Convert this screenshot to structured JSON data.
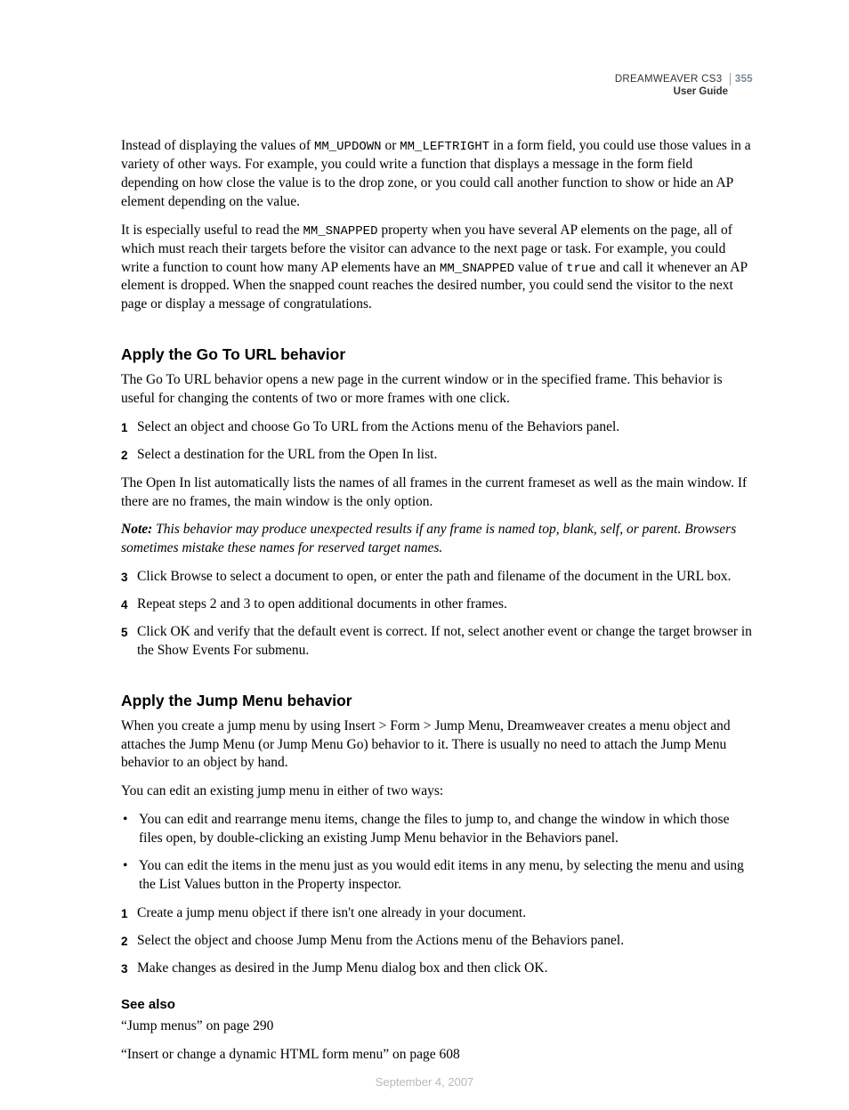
{
  "header": {
    "product": "DREAMWEAVER CS3",
    "doc": "User Guide",
    "page": "355"
  },
  "intro": {
    "p1_a": "Instead of displaying the values of ",
    "p1_code1": "MM_UPDOWN",
    "p1_b": " or ",
    "p1_code2": "MM_LEFTRIGHT",
    "p1_c": " in a form field, you could use those values in a variety of other ways. For example, you could write a function that displays a message in the form field depending on how close the value is to the drop zone, or you could call another function to show or hide an AP element depending on the value.",
    "p2_a": "It is especially useful to read the ",
    "p2_code1": "MM_SNAPPED",
    "p2_b": " property when you have several AP elements on the page, all of which must reach their targets before the visitor can advance to the next page or task. For example, you could write a function to count how many AP elements have an ",
    "p2_code2": "MM_SNAPPED",
    "p2_c": " value of ",
    "p2_code3": "true",
    "p2_d": " and call it whenever an AP element is dropped. When the snapped count reaches the desired number, you could send the visitor to the next page or display a message of congratulations."
  },
  "go_to_url": {
    "heading": "Apply the Go To URL behavior",
    "intro": "The Go To URL behavior opens a new page in the current window or in the specified frame. This behavior is useful for changing the contents of two or more frames with one click.",
    "steps12": {
      "s1": {
        "n": "1",
        "t": "Select an object and choose Go To URL from the Actions menu of the Behaviors panel."
      },
      "s2": {
        "n": "2",
        "t": "Select a destination for the URL from the Open In list."
      }
    },
    "mid_para": "The Open In list automatically lists the names of all frames in the current frameset as well as the main window. If there are no frames, the main window is the only option.",
    "note_label": "Note:",
    "note_body": " This behavior may produce unexpected results if any frame is named top, blank, self, or parent. Browsers sometimes mistake these names for reserved target names.",
    "steps345": {
      "s3": {
        "n": "3",
        "t": "Click Browse to select a document to open, or enter the path and filename of the document in the URL box."
      },
      "s4": {
        "n": "4",
        "t": "Repeat steps 2 and 3 to open additional documents in other frames."
      },
      "s5": {
        "n": "5",
        "t": "Click OK and verify that the default event is correct. If not, select another event or change the target browser in the Show Events For submenu."
      }
    }
  },
  "jump_menu": {
    "heading": "Apply the Jump Menu behavior",
    "intro": "When you create a jump menu by using Insert > Form > Jump Menu, Dreamweaver creates a menu object and attaches the Jump Menu (or Jump Menu Go) behavior to it. There is usually no need to attach the Jump Menu behavior to an object by hand.",
    "lead": "You can edit an existing jump menu in either of two ways:",
    "bullets": {
      "b1": "You can edit and rearrange menu items, change the files to jump to, and change the window in which those files open, by double-clicking an existing Jump Menu behavior in the Behaviors panel.",
      "b2": "You can edit the items in the menu just as you would edit items in any menu, by selecting the menu and using the List Values button in the Property inspector."
    },
    "steps": {
      "s1": {
        "n": "1",
        "t": "Create a jump menu object if there isn't one already in your document."
      },
      "s2": {
        "n": "2",
        "t": "Select the object and choose Jump Menu from the Actions menu of the Behaviors panel."
      },
      "s3": {
        "n": "3",
        "t": "Make changes as desired in the Jump Menu dialog box and then click OK."
      }
    }
  },
  "see_also": {
    "heading": "See also",
    "l1": "“Jump menus” on page 290",
    "l2": "“Insert or change a dynamic HTML form menu” on page 608"
  },
  "footer_date": "September 4, 2007"
}
